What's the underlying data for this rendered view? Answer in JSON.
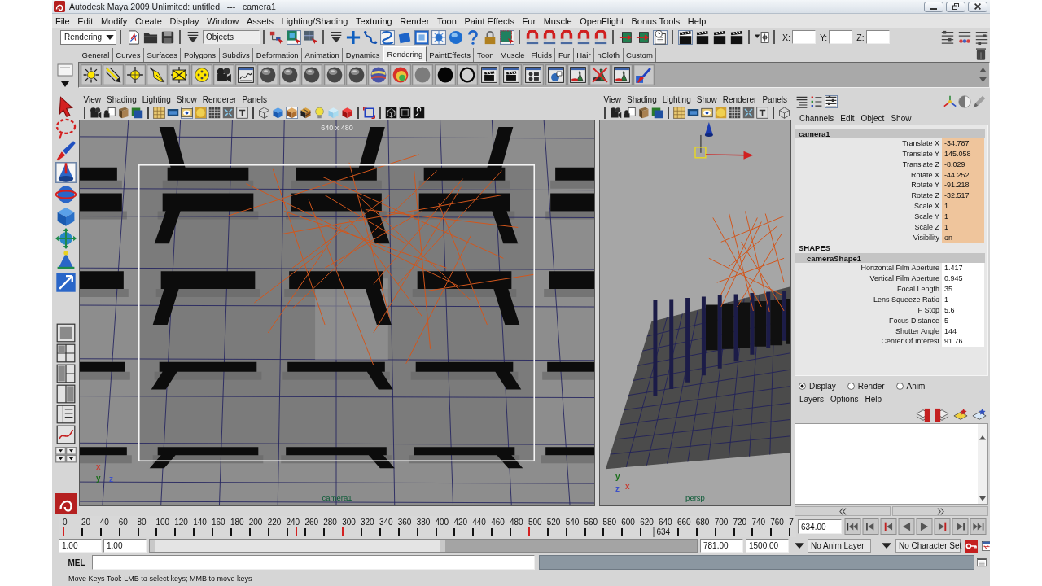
{
  "window": {
    "title": "Autodesk Maya 2009 Unlimited: untitled   ---   camera1"
  },
  "menu_bar": [
    "File",
    "Edit",
    "Modify",
    "Create",
    "Display",
    "Window",
    "Assets",
    "Lighting/Shading",
    "Texturing",
    "Render",
    "Toon",
    "Paint Effects",
    "Fur",
    "Muscle",
    "OpenFlight",
    "Bonus Tools",
    "Help"
  ],
  "status_line": {
    "menu_set": "Rendering",
    "selection_mode": "Objects",
    "tools": [
      {
        "on": false
      },
      {
        "on": false
      },
      {
        "on": false
      },
      {
        "on": false
      },
      {
        "on": false
      },
      {
        "on": true
      },
      {
        "on": false
      },
      {
        "on": false
      },
      {
        "on": false
      },
      {
        "on": false
      },
      {
        "on": true
      },
      {
        "on": false
      },
      {
        "on": true
      },
      {
        "on": true
      },
      {
        "on": false
      },
      {
        "on": false
      },
      {
        "on": false
      },
      {
        "on": true
      },
      {
        "on": false
      },
      {
        "on": false
      },
      {
        "on": false
      },
      {
        "on": false
      },
      {
        "on": false
      },
      {
        "on": false
      },
      {
        "on": false
      },
      {
        "on": true
      },
      {
        "on": true
      },
      {
        "on": false
      },
      {
        "on": false
      },
      {
        "on": false
      },
      {
        "on": false
      }
    ],
    "coordinate_fields": [
      {
        "label": "X:"
      },
      {
        "label": "Y:"
      },
      {
        "label": "Z:"
      }
    ]
  },
  "shelf": {
    "tabs": [
      {
        "label": "General",
        "selected": false
      },
      {
        "label": "Curves",
        "selected": false
      },
      {
        "label": "Surfaces",
        "selected": false
      },
      {
        "label": "Polygons",
        "selected": false
      },
      {
        "label": "Subdivs",
        "selected": false
      },
      {
        "label": "Deformation",
        "selected": false
      },
      {
        "label": "Animation",
        "selected": false
      },
      {
        "label": "Dynamics",
        "selected": false
      },
      {
        "label": "Rendering",
        "selected": true
      },
      {
        "label": "PaintEffects",
        "selected": false
      },
      {
        "label": "Toon",
        "selected": false
      },
      {
        "label": "Muscle",
        "selected": false
      },
      {
        "label": "Fluids",
        "selected": false
      },
      {
        "label": "Fur",
        "selected": false
      },
      {
        "label": "Hair",
        "selected": false
      },
      {
        "label": "nCloth",
        "selected": false
      },
      {
        "label": "Custom",
        "selected": false
      }
    ]
  },
  "toolbox": {
    "tools": [
      {
        "selected": false
      },
      {
        "selected": false
      },
      {
        "selected": false
      },
      {
        "selected": true
      },
      {
        "selected": false
      },
      {
        "selected": false
      },
      {
        "selected": false
      },
      {
        "selected": false
      },
      {
        "selected": false
      }
    ]
  },
  "viewports": [
    {
      "menu": [
        "View",
        "Shading",
        "Lighting",
        "Show",
        "Renderer",
        "Panels"
      ],
      "toolbar": [
        {
          "on": false
        },
        {
          "on": false
        },
        {
          "on": false
        },
        {
          "on": false
        },
        {
          "on": true
        },
        {
          "on": false
        },
        {
          "on": true
        },
        {
          "on": true
        },
        {
          "on": false
        },
        {
          "on": false
        },
        {
          "on": false
        },
        {
          "on": false
        },
        {
          "on": false
        },
        {
          "on": true
        },
        {
          "on": false
        },
        {
          "on": false
        },
        {
          "on": false
        },
        {
          "on": false
        },
        {
          "on": false
        },
        {
          "on": false
        },
        {
          "on": false
        },
        {
          "on": false
        }
      ],
      "resolution": "640 x 480",
      "camera": "camera1",
      "axis_labels": [
        {
          "text": "x",
          "color": "#c83c32"
        },
        {
          "text": "y",
          "color": "#1a6e1a"
        },
        {
          "text": "z",
          "color": "#3c50c8"
        }
      ]
    },
    {
      "menu": [
        "View",
        "Shading",
        "Lighting",
        "Show",
        "Renderer",
        "Panels"
      ],
      "toolbar": [
        {
          "on": false
        },
        {
          "on": false
        },
        {
          "on": false
        },
        {
          "on": false
        },
        {
          "on": true
        },
        {
          "on": false
        },
        {
          "on": false
        },
        {
          "on": false
        },
        {
          "on": false
        },
        {
          "on": false
        },
        {
          "on": false
        },
        {
          "on": false
        }
      ],
      "camera": "persp",
      "axis_labels": [
        {
          "text": "x",
          "color": "#c83c32"
        },
        {
          "text": "y",
          "color": "#1a6e1a"
        },
        {
          "text": "z",
          "color": "#3c50c8"
        }
      ]
    }
  ],
  "channel_box": {
    "layout_buttons": [
      {
        "on": false
      },
      {
        "on": false
      },
      {
        "on": true
      }
    ],
    "menu": [
      "Channels",
      "Edit",
      "Object",
      "Show"
    ],
    "node": "camera1",
    "channels": [
      {
        "name": "Translate X",
        "value": "-34.787",
        "keyed": true
      },
      {
        "name": "Translate Y",
        "value": "145.058",
        "keyed": true
      },
      {
        "name": "Translate Z",
        "value": "-8.029",
        "keyed": true
      },
      {
        "name": "Rotate X",
        "value": "-44.252",
        "keyed": true
      },
      {
        "name": "Rotate Y",
        "value": "-91.218",
        "keyed": true
      },
      {
        "name": "Rotate Z",
        "value": "-32.517",
        "keyed": true
      },
      {
        "name": "Scale X",
        "value": "1",
        "keyed": true
      },
      {
        "name": "Scale Y",
        "value": "1",
        "keyed": true
      },
      {
        "name": "Scale Z",
        "value": "1",
        "keyed": true
      },
      {
        "name": "Visibility",
        "value": "on",
        "keyed": true
      }
    ],
    "shapes_heading": "SHAPES",
    "shape_node": "cameraShape1",
    "shape_channels": [
      {
        "name": "Horizontal Film Aperture",
        "value": "1.417",
        "keyed": false
      },
      {
        "name": "Vertical Film Aperture",
        "value": "0.945",
        "keyed": false
      },
      {
        "name": "Focal Length",
        "value": "35",
        "keyed": false
      },
      {
        "name": "Lens Squeeze Ratio",
        "value": "1",
        "keyed": false
      },
      {
        "name": "F Stop",
        "value": "5.6",
        "keyed": false
      },
      {
        "name": "Focus Distance",
        "value": "5",
        "keyed": false
      },
      {
        "name": "Shutter Angle",
        "value": "144",
        "keyed": false
      },
      {
        "name": "Center Of Interest",
        "value": "91.76",
        "keyed": false
      }
    ]
  },
  "layer_editor": {
    "modes": [
      {
        "label": "Display",
        "selected": true
      },
      {
        "label": "Render",
        "selected": false
      },
      {
        "label": "Anim",
        "selected": false
      }
    ],
    "menu": [
      "Layers",
      "Options",
      "Help"
    ]
  },
  "time_slider": {
    "ticks": [
      "0",
      "20",
      "40",
      "60",
      "80",
      "100",
      "120",
      "140",
      "160",
      "180",
      "200",
      "220",
      "240",
      "260",
      "280",
      "300",
      "320",
      "340",
      "360",
      "380",
      "400",
      "420",
      "440",
      "460",
      "480",
      "500",
      "520",
      "540",
      "560",
      "580",
      "600",
      "620",
      "640",
      "660",
      "680",
      "700",
      "720",
      "740",
      "760",
      "7"
    ],
    "keyframes": [
      {
        "level": 0
      },
      {
        "level": 0.3205
      },
      {
        "level": 0.3846
      },
      {
        "level": 0.641
      }
    ],
    "current_frame_label": "634",
    "current_frame": "634.00"
  },
  "range_slider": {
    "start": "1.00",
    "range_start": "1.00",
    "range_bar": {
      "level": 0.54
    },
    "range_end": "781.00",
    "end": "1500.00",
    "anim_layer": "No Anim Layer",
    "character_set": "No Character Set"
  },
  "command_line": {
    "language": "MEL"
  },
  "help_line": "Move Keys Tool: LMB to select keys; MMB to move keys"
}
